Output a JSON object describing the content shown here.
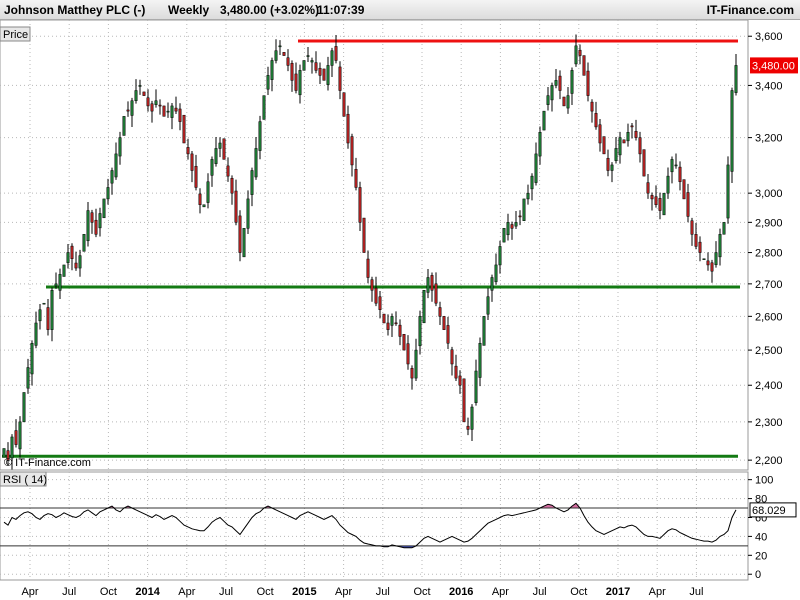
{
  "header": {
    "instrument": "Johnson Matthey PLC (-)",
    "period": "Weekly",
    "quote": "3,480.00 (+3.02%)",
    "time": "11:07:39",
    "brand": "IT-Finance.com"
  },
  "price_panel": {
    "label": "Price",
    "watermark": "© IT-Finance.com",
    "last_price_label": "3,480.00"
  },
  "rsi_panel": {
    "label": "RSI ( 14)",
    "last_value_label": "68.029"
  },
  "chart_data": [
    {
      "type": "candlestick",
      "title": "Johnson Matthey PLC (-)",
      "ylabel": "Price",
      "ylim": [
        2180,
        3660
      ],
      "y_ticks": [
        2200,
        2300,
        2400,
        2500,
        2600,
        2700,
        2800,
        2900,
        3000,
        3200,
        3400,
        3600
      ],
      "y_tick_labels": [
        "2,200",
        "2,300",
        "2,400",
        "2,500",
        "2,600",
        "2,700",
        "2,800",
        "2,900",
        "3,000",
        "3,200",
        "3,400",
        "3,600"
      ],
      "x_tick_labels": [
        "Apr",
        "Jul",
        "Oct",
        "2014",
        "Apr",
        "Jul",
        "Oct",
        "2015",
        "Apr",
        "Jul",
        "Oct",
        "2016",
        "Apr",
        "Jul",
        "Oct",
        "2017",
        "Apr",
        "Jul"
      ],
      "bold_x_labels": [
        "2014",
        "2015",
        "2016",
        "2017"
      ],
      "last_close": 3480,
      "series": [
        {
          "values": [
            2230,
            2200,
            2260,
            2240,
            2300,
            2380,
            2450,
            2520,
            2580,
            2620,
            2640,
            2560,
            2680,
            2700,
            2730,
            2760,
            2800,
            2780,
            2750,
            2790,
            2860,
            2940,
            2900,
            2860,
            2930,
            2980,
            3020,
            3080,
            3140,
            3200,
            3280,
            3300,
            3340,
            3380,
            3400,
            3360,
            3320,
            3300,
            3340,
            3320,
            3280,
            3300,
            3320,
            3300,
            3260,
            3180,
            3140,
            3080,
            3020,
            2960,
            2960,
            3040,
            3120,
            3160,
            3180,
            3120,
            3060,
            3000,
            2900,
            2800,
            2880,
            2980,
            3080,
            3160,
            3260,
            3360,
            3440,
            3500,
            3540,
            3560,
            3520,
            3480,
            3420,
            3380,
            3460,
            3500,
            3520,
            3500,
            3460,
            3440,
            3420,
            3480,
            3540,
            3500,
            3380,
            3280,
            3180,
            3100,
            3020,
            2900,
            2800,
            2720,
            2680,
            2640,
            2620,
            2580,
            2560,
            2600,
            2580,
            2540,
            2500,
            2460,
            2420,
            2500,
            2600,
            2680,
            2720,
            2680,
            2640,
            2600,
            2560,
            2520,
            2460,
            2420,
            2400,
            2300,
            2280,
            2340,
            2440,
            2520,
            2600,
            2660,
            2720,
            2760,
            2820,
            2880,
            2900,
            2880,
            2900,
            2920,
            2980,
            3000,
            3060,
            3140,
            3220,
            3300,
            3360,
            3400,
            3420,
            3380,
            3320,
            3360,
            3460,
            3560,
            3520,
            3440,
            3360,
            3300,
            3240,
            3180,
            3140,
            3080,
            3100,
            3160,
            3200,
            3180,
            3220,
            3240,
            3200,
            3140,
            3060,
            3000,
            2980,
            2960,
            2940,
            3000,
            3060,
            3120,
            3100,
            3040,
            2980,
            2920,
            2860,
            2820,
            2800,
            2780,
            2760,
            2740,
            2800,
            2860,
            2900,
            3100,
            3380,
            3480
          ]
        }
      ]
    },
    {
      "type": "line",
      "title": "RSI ( 14)",
      "ylim": [
        -4,
        106
      ],
      "y_ticks": [
        0,
        20,
        40,
        60,
        80,
        100
      ],
      "levels": [
        30,
        70
      ],
      "last_value": 68.029,
      "series": [
        {
          "values": [
            55,
            52,
            60,
            58,
            62,
            65,
            66,
            64,
            60,
            58,
            62,
            64,
            63,
            60,
            62,
            65,
            63,
            61,
            60,
            62,
            66,
            68,
            65,
            62,
            66,
            68,
            70,
            72,
            68,
            66,
            70,
            72,
            70,
            68,
            66,
            64,
            62,
            60,
            63,
            61,
            58,
            60,
            62,
            60,
            56,
            52,
            50,
            48,
            47,
            46,
            46,
            50,
            55,
            58,
            60,
            56,
            52,
            50,
            46,
            42,
            48,
            54,
            60,
            64,
            66,
            70,
            72,
            70,
            68,
            66,
            64,
            62,
            60,
            58,
            62,
            64,
            66,
            64,
            62,
            60,
            58,
            60,
            62,
            58,
            52,
            48,
            44,
            42,
            40,
            36,
            33,
            32,
            31,
            30,
            30,
            29,
            29,
            31,
            30,
            29,
            28,
            28,
            28,
            30,
            34,
            38,
            40,
            38,
            36,
            34,
            36,
            38,
            40,
            38,
            36,
            34,
            35,
            38,
            42,
            46,
            50,
            54,
            56,
            58,
            60,
            62,
            63,
            62,
            63,
            64,
            65,
            66,
            67,
            68,
            70,
            72,
            74,
            73,
            70,
            68,
            66,
            68,
            72,
            75,
            70,
            62,
            55,
            50,
            46,
            44,
            42,
            44,
            46,
            48,
            50,
            49,
            51,
            52,
            50,
            46,
            42,
            40,
            40,
            39,
            38,
            42,
            46,
            48,
            47,
            44,
            42,
            40,
            38,
            37,
            36,
            35,
            35,
            34,
            36,
            40,
            42,
            46,
            60,
            68.029
          ]
        }
      ]
    }
  ],
  "colors": {
    "bull": "#1f7a35",
    "bear": "#b22222",
    "resistance": "#ee1111",
    "support": "#137a13",
    "rsi_line": "#000000",
    "rsi_overbought_fill": "#c94a8a",
    "rsi_oversold_fill": "#2c3fbf",
    "grid": "#b8b8b8"
  },
  "annotations": {
    "resistance_level": 3580,
    "support_level_upper": 2690,
    "support_level_lower": 2210
  }
}
